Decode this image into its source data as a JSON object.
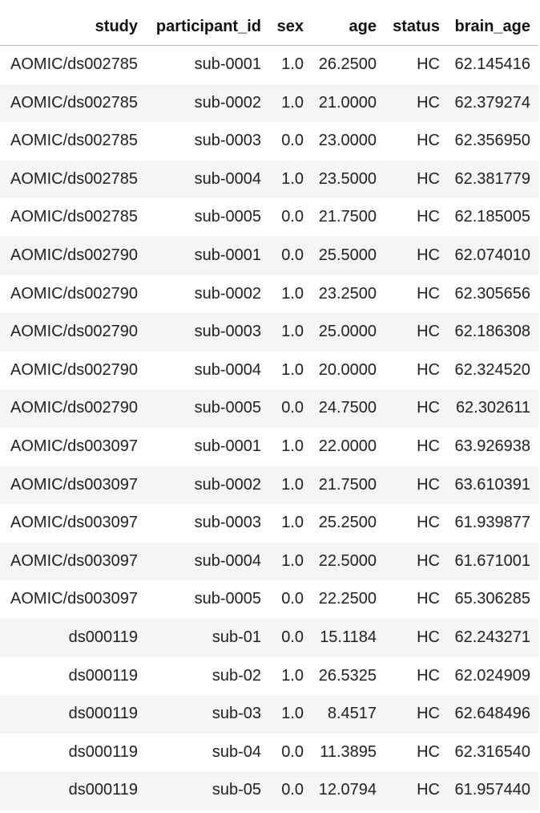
{
  "table": {
    "columns": [
      "study",
      "participant_id",
      "sex",
      "age",
      "status",
      "brain_age"
    ],
    "rows": [
      [
        "AOMIC/ds002785",
        "sub-0001",
        "1.0",
        "26.2500",
        "HC",
        "62.145416"
      ],
      [
        "AOMIC/ds002785",
        "sub-0002",
        "1.0",
        "21.0000",
        "HC",
        "62.379274"
      ],
      [
        "AOMIC/ds002785",
        "sub-0003",
        "0.0",
        "23.0000",
        "HC",
        "62.356950"
      ],
      [
        "AOMIC/ds002785",
        "sub-0004",
        "1.0",
        "23.5000",
        "HC",
        "62.381779"
      ],
      [
        "AOMIC/ds002785",
        "sub-0005",
        "0.0",
        "21.7500",
        "HC",
        "62.185005"
      ],
      [
        "AOMIC/ds002790",
        "sub-0001",
        "0.0",
        "25.5000",
        "HC",
        "62.074010"
      ],
      [
        "AOMIC/ds002790",
        "sub-0002",
        "1.0",
        "23.2500",
        "HC",
        "62.305656"
      ],
      [
        "AOMIC/ds002790",
        "sub-0003",
        "1.0",
        "25.0000",
        "HC",
        "62.186308"
      ],
      [
        "AOMIC/ds002790",
        "sub-0004",
        "1.0",
        "20.0000",
        "HC",
        "62.324520"
      ],
      [
        "AOMIC/ds002790",
        "sub-0005",
        "0.0",
        "24.7500",
        "HC",
        "62.302611"
      ],
      [
        "AOMIC/ds003097",
        "sub-0001",
        "1.0",
        "22.0000",
        "HC",
        "63.926938"
      ],
      [
        "AOMIC/ds003097",
        "sub-0002",
        "1.0",
        "21.7500",
        "HC",
        "63.610391"
      ],
      [
        "AOMIC/ds003097",
        "sub-0003",
        "1.0",
        "25.2500",
        "HC",
        "61.939877"
      ],
      [
        "AOMIC/ds003097",
        "sub-0004",
        "1.0",
        "22.5000",
        "HC",
        "61.671001"
      ],
      [
        "AOMIC/ds003097",
        "sub-0005",
        "0.0",
        "22.2500",
        "HC",
        "65.306285"
      ],
      [
        "ds000119",
        "sub-01",
        "0.0",
        "15.1184",
        "HC",
        "62.243271"
      ],
      [
        "ds000119",
        "sub-02",
        "1.0",
        "26.5325",
        "HC",
        "62.024909"
      ],
      [
        "ds000119",
        "sub-03",
        "1.0",
        "8.4517",
        "HC",
        "62.648496"
      ],
      [
        "ds000119",
        "sub-04",
        "0.0",
        "11.3895",
        "HC",
        "62.316540"
      ],
      [
        "ds000119",
        "sub-05",
        "0.0",
        "12.0794",
        "HC",
        "61.957440"
      ]
    ]
  },
  "colors": {
    "header_border": "#bdbdbd",
    "row_stripe": "#f5f5f5",
    "text": "#212121"
  }
}
